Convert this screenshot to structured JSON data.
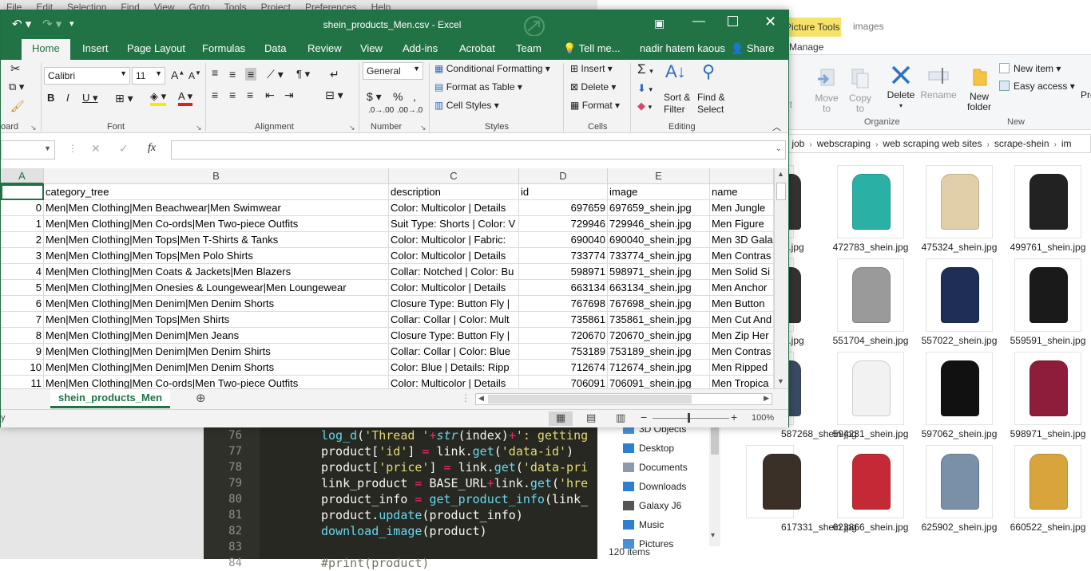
{
  "editor": {
    "menu": [
      "File",
      "Edit",
      "Selection",
      "Find",
      "View",
      "Goto",
      "Tools",
      "Project",
      "Preferences",
      "Help"
    ],
    "lines": [
      {
        "no": "76",
        "html": "<span style='color:#66d9ef'>log_d</span>(<span style='color:#e6db74'>'Thread '</span><span style='color:#f92672'>+</span><span style='color:#66d9ef;font-style:italic'>str</span>(index)<span style='color:#f92672'>+</span><span style='color:#e6db74'>': getting</span>"
      },
      {
        "no": "77",
        "html": "product[<span style='color:#e6db74'>'id'</span>] <span style='color:#f92672'>=</span> link.<span style='color:#66d9ef'>get</span>(<span style='color:#e6db74'>'data-id'</span>)"
      },
      {
        "no": "78",
        "html": "product[<span style='color:#e6db74'>'price'</span>] <span style='color:#f92672'>=</span> link.<span style='color:#66d9ef'>get</span>(<span style='color:#e6db74'>'data-pri</span>"
      },
      {
        "no": "79",
        "html": "link_product <span style='color:#f92672'>=</span> BASE_URL<span style='color:#f92672'>+</span>link.<span style='color:#66d9ef'>get</span>(<span style='color:#e6db74'>'hre</span>"
      },
      {
        "no": "80",
        "html": "product_info <span style='color:#f92672'>=</span> <span style='color:#66d9ef'>get_product_info</span>(link_"
      },
      {
        "no": "81",
        "html": "product.<span style='color:#66d9ef'>update</span>(product_info)"
      },
      {
        "no": "82",
        "html": "<span style='color:#66d9ef'>download_image</span>(product)"
      },
      {
        "no": "83",
        "html": ""
      },
      {
        "no": "84",
        "html": "<span style='color:#75715e'>#print(product)</span>"
      }
    ]
  },
  "explorer": {
    "picture_tools": "Picture Tools",
    "images_tab": "images",
    "manage_tab": "Manage",
    "ribbon": {
      "move_to": "Move to",
      "copy_to": "Copy to",
      "delete": "Delete",
      "rename": "Rename",
      "new_folder": "New folder",
      "new_item": "New item",
      "easy_access": "Easy access",
      "pro": "Pro",
      "cut": "ut",
      "organize": "Organize",
      "new": "New"
    },
    "breadcrumb": [
      "job",
      "webscraping",
      "web scraping web sites",
      "scrape-shein",
      "im"
    ],
    "nav_items": [
      {
        "label": "3D Objects",
        "color": "#4a90d9"
      },
      {
        "label": "Desktop",
        "color": "#2d7fd3"
      },
      {
        "label": "Documents",
        "color": "#8c9bab"
      },
      {
        "label": "Downloads",
        "color": "#2d7fd3"
      },
      {
        "label": "Galaxy J6",
        "color": "#555"
      },
      {
        "label": "Music",
        "color": "#2d7fd3"
      },
      {
        "label": "Pictures",
        "color": "#4a90d9"
      }
    ],
    "item_count": "120 items",
    "thumbnails": [
      {
        "name": "in.jpg",
        "color": "#333"
      },
      {
        "name": "472783_shein.jpg",
        "color": "#2bb0a6"
      },
      {
        "name": "475324_shein.jpg",
        "color": "#e0cfa8"
      },
      {
        "name": "499761_shein.jpg",
        "color": "#222"
      },
      {
        "name": "in.jpg",
        "color": "#333"
      },
      {
        "name": "551704_shein.jpg",
        "color": "#9a9a9a"
      },
      {
        "name": "557022_shein.jpg",
        "color": "#1e2e55"
      },
      {
        "name": "559591_shein.jpg",
        "color": "#1a1a1a"
      },
      {
        "name": "587268_shein.jpg",
        "color": "#3b4a63"
      },
      {
        "name": "594231_shein.jpg",
        "color": "#f2f2f2"
      },
      {
        "name": "597062_shein.jpg",
        "color": "#111"
      },
      {
        "name": "598971_shein.jpg",
        "color": "#8e1d3c"
      },
      {
        "name": "617331_shein.jpg",
        "color": "#3a3028"
      },
      {
        "name": "623866_shein.jpg",
        "color": "#c32a36"
      },
      {
        "name": "625902_shein.jpg",
        "color": "#7a8fa8"
      },
      {
        "name": "660522_shein.jpg",
        "color": "#d9a43b"
      }
    ]
  },
  "excel": {
    "title": "shein_products_Men.csv - Excel",
    "tabs": [
      "Home",
      "Insert",
      "Page Layout",
      "Formulas",
      "Data",
      "Review",
      "View",
      "Add-ins",
      "Acrobat",
      "Team",
      "Tell me...",
      "nadir hatem kaous",
      "Share"
    ],
    "font_name": "Calibri",
    "font_size": "11",
    "number_format": "General",
    "styles": [
      "Conditional Formatting",
      "Format as Table",
      "Cell Styles"
    ],
    "cells_group": [
      "Insert",
      "Delete",
      "Format"
    ],
    "editing": {
      "sort": "Sort & Filter",
      "find": "Find & Select"
    },
    "groups": [
      "oard",
      "Font",
      "Alignment",
      "Number",
      "Styles",
      "Cells",
      "Editing"
    ],
    "columns": [
      "A",
      "B",
      "C",
      "D",
      "E"
    ],
    "header": [
      "",
      "category_tree",
      "description",
      "id",
      "image",
      "name"
    ],
    "rows": [
      [
        "0",
        "Men|Men Clothing|Men Beachwear|Men Swimwear",
        "Color: Multicolor | Details",
        "697659",
        "697659_shein.jpg",
        "Men Jungle"
      ],
      [
        "1",
        "Men|Men Clothing|Men Co-ords|Men Two-piece Outfits",
        "Suit Type: Shorts | Color: V",
        "729946",
        "729946_shein.jpg",
        "Men Figure"
      ],
      [
        "2",
        "Men|Men Clothing|Men Tops|Men T-Shirts & Tanks",
        "Color: Multicolor | Fabric:",
        "690040",
        "690040_shein.jpg",
        "Men 3D Gala"
      ],
      [
        "3",
        "Men|Men Clothing|Men Tops|Men Polo Shirts",
        "Color: Multicolor | Details",
        "733774",
        "733774_shein.jpg",
        "Men Contras"
      ],
      [
        "4",
        "Men|Men Clothing|Men Coats & Jackets|Men Blazers",
        "Collar: Notched | Color: Bu",
        "598971",
        "598971_shein.jpg",
        "Men Solid Si"
      ],
      [
        "5",
        "Men|Men Clothing|Men Onesies & Loungewear|Men Loungewear",
        "Color: Multicolor | Details",
        "663134",
        "663134_shein.jpg",
        "Men Anchor"
      ],
      [
        "6",
        "Men|Men Clothing|Men Denim|Men Denim Shorts",
        "Closure Type: Button Fly |",
        "767698",
        "767698_shein.jpg",
        "Men Button"
      ],
      [
        "7",
        "Men|Men Clothing|Men Tops|Men Shirts",
        "Collar: Collar | Color: Mult",
        "735861",
        "735861_shein.jpg",
        "Men Cut And"
      ],
      [
        "8",
        "Men|Men Clothing|Men Denim|Men Jeans",
        "Closure Type: Button Fly |",
        "720670",
        "720670_shein.jpg",
        "Men Zip Her"
      ],
      [
        "9",
        "Men|Men Clothing|Men Denim|Men Denim Shirts",
        "Collar: Collar | Color: Blue",
        "753189",
        "753189_shein.jpg",
        "Men Contras"
      ],
      [
        "10",
        "Men|Men Clothing|Men Denim|Men Denim Shorts",
        "Color: Blue | Details: Ripp",
        "712674",
        "712674_shein.jpg",
        "Men Ripped"
      ],
      [
        "11",
        "Men|Men Clothing|Men Co-ords|Men Two-piece Outfits",
        "Color: Multicolor | Details",
        "706091",
        "706091_shein.jpg",
        "Men Tropica"
      ]
    ],
    "sheet_tab": "shein_products_Men",
    "status_left": "y",
    "zoom": "100%"
  }
}
